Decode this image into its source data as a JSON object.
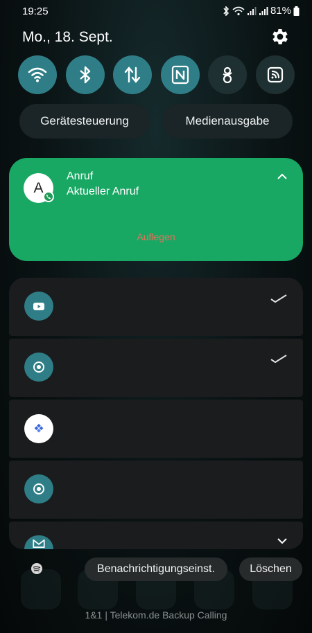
{
  "status_bar": {
    "time": "19:25",
    "battery": "81%",
    "icons": [
      "bluetooth-icon",
      "wifi-icon",
      "signal-icon",
      "signal-icon",
      "battery-icon"
    ]
  },
  "header": {
    "date": "Mo., 18. Sept.",
    "settings_icon": "gear-icon"
  },
  "quick_tiles": [
    {
      "name": "wifi",
      "icon": "wifi-icon",
      "active": true
    },
    {
      "name": "bluetooth",
      "icon": "bluetooth-icon",
      "active": true
    },
    {
      "name": "mobile-data",
      "icon": "data-arrows-icon",
      "active": true
    },
    {
      "name": "nfc",
      "icon": "nfc-icon",
      "active": true
    },
    {
      "name": "vpn",
      "icon": "vpn-icon",
      "active": false
    },
    {
      "name": "cast",
      "icon": "cast-icon",
      "active": false
    }
  ],
  "pills": {
    "device_control": "Gerätesteuerung",
    "media_output": "Medienausgabe"
  },
  "call_notification": {
    "avatar_letter": "A",
    "title": "Anruf",
    "subtitle": "Aktueller Anruf",
    "action": "Auflegen",
    "color": "#18a864"
  },
  "notifications": [
    {
      "app_icon": "youtube-icon"
    },
    {
      "app_icon": "chrome-icon"
    },
    {
      "app_icon": "puzzle-app-icon"
    },
    {
      "app_icon": "chrome-icon"
    },
    {
      "app_icon": "gmail-icon"
    }
  ],
  "footer": {
    "notification_settings": "Benachrichtigungseinst.",
    "clear": "Löschen",
    "carrier": "1&1 | Telekom.de Backup Calling"
  }
}
